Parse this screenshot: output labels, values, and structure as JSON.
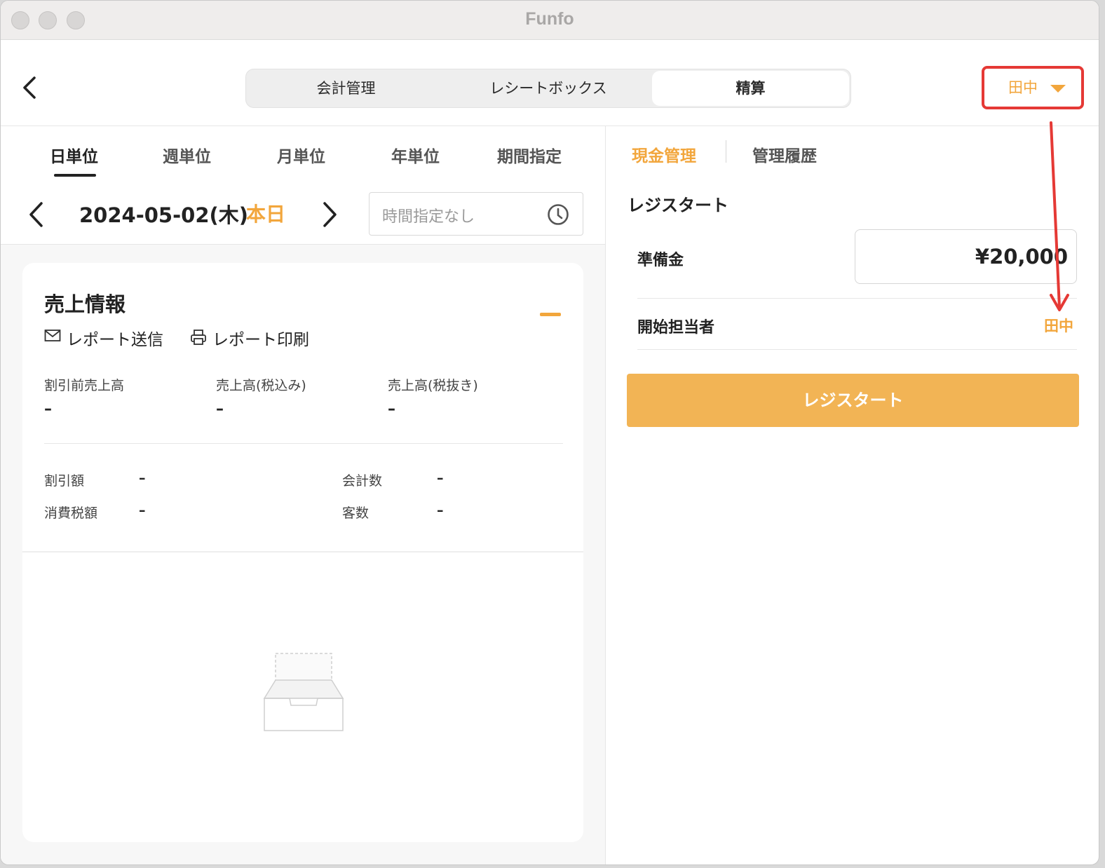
{
  "window": {
    "title": "Funfo"
  },
  "header": {
    "tabs": [
      "会計管理",
      "レシートボックス",
      "精算"
    ],
    "active_tab": "精算",
    "user": "田中"
  },
  "left": {
    "period_tabs": [
      "日単位",
      "週単位",
      "月単位",
      "年単位",
      "期間指定"
    ],
    "active_period": "日単位",
    "date": "2024-05-02(木)",
    "today_label": "本日",
    "time_placeholder": "時間指定なし",
    "card": {
      "title": "売上情報",
      "send_report": "レポート送信",
      "print_report": "レポート印刷",
      "metrics": [
        {
          "label": "割引前売上高",
          "value": "–"
        },
        {
          "label": "売上高(税込み)",
          "value": "–"
        },
        {
          "label": "売上高(税抜き)",
          "value": "–"
        }
      ],
      "stats": [
        {
          "label": "割引額",
          "value": "–"
        },
        {
          "label": "会計数",
          "value": "–"
        },
        {
          "label": "消費税額",
          "value": "–"
        },
        {
          "label": "客数",
          "value": "–"
        }
      ]
    }
  },
  "right": {
    "tabs": [
      "現金管理",
      "管理履歴"
    ],
    "active_tab": "現金管理",
    "section_title": "レジスタート",
    "float_label": "準備金",
    "float_value": "¥20,000",
    "staff_label": "開始担当者",
    "staff_value": "田中",
    "start_button": "レジスタート"
  },
  "colors": {
    "accent": "#f2a63c",
    "button": "#f2b455",
    "annotation": "#e53935"
  },
  "icons": [
    "back-chevron-icon",
    "caret-down-icon",
    "chevron-left-icon",
    "chevron-right-icon",
    "clock-icon",
    "mail-icon",
    "printer-icon",
    "minus-icon",
    "empty-box-icon"
  ]
}
